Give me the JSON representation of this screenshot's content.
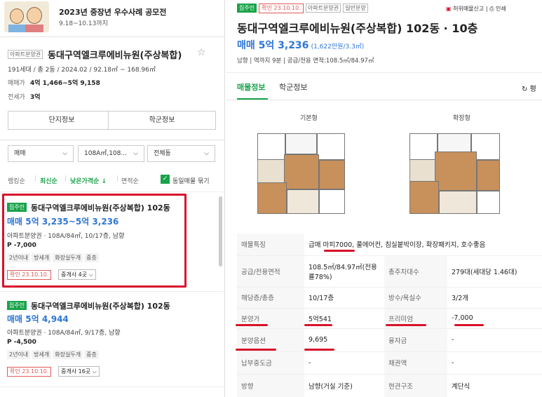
{
  "banner": {
    "title": "2023년 중장년 우수사례 공모전",
    "dates": "9.18~10.13까지"
  },
  "complex": {
    "badge": "아파트분양권",
    "name": "동대구역엘크루에비뉴원(주상복합)",
    "summary": "191세대 / 총 2동 / 2024.02 / 92.18㎡ ~ 168.96㎡",
    "sale_label": "매매가",
    "sale_value": "4억 1,466~5억 9,158",
    "jeonse_label": "전세가",
    "jeonse_value": "3억"
  },
  "buttons": {
    "complex_info": "단지정보",
    "school_info": "학군정보"
  },
  "filters": {
    "type": "매매",
    "area": "108A㎡,108...",
    "building": "전체동"
  },
  "sort": {
    "ranking": "랭킹순",
    "latest": "최신순",
    "low_price": "낮은가격순 ↓",
    "area": "면적순",
    "same_listing": "동일매물 묶기"
  },
  "listings": [
    {
      "badge": "집주인",
      "title": "동대구역엘크루에비뉴원(주상복합) 102동",
      "price": "매매 5억 3,235~5억 3,236",
      "detail": "아파트분양권 · 108A/84㎡, 10/17층, 남향",
      "premium": "P -7,000",
      "features": [
        "2년이내",
        "방세개",
        "화장실두개",
        "중층"
      ],
      "confirmed": "확인 23.10.10.",
      "agents": "중개사 4곳"
    },
    {
      "badge": "집주인",
      "title": "동대구역엘크루에비뉴원(주상복합) 102동",
      "price": "매매 5억 4,944",
      "detail": "아파트분양권 · 108A/84㎡, 9/17층, 남향",
      "premium": "P -4,500",
      "features": [
        "2년이내",
        "방세개",
        "화장실두개",
        "중층"
      ],
      "confirmed": "확인 23.10.10.",
      "agents": "중개사 16곳"
    }
  ],
  "detail": {
    "tags": [
      "집주인",
      "확인 23.10.10.",
      "아파트분양권",
      "일반분양"
    ],
    "report_link": "허위매물신고",
    "print_link": "인쇄",
    "title": "동대구역엘크루에비뉴원(주상복합) 102동 · 10층",
    "price_main": "매매 5억 3,236",
    "price_sub": "(1,622만원/3.3㎡)",
    "meta": "남향 | 역까지 9분 | 공급/전용 면적:108.5㎡/84.97㎡",
    "tabs": [
      "매물정보",
      "학군정보"
    ],
    "refresh": "평",
    "plan_basic": "기본형",
    "plan_extended": "확장형",
    "rows": [
      {
        "k1": "매물특징",
        "v1": "급매 마피7000, 풀에어컨, 침실붙박이장, 확장패키지, 호수좋음",
        "k2": "",
        "v2": ""
      },
      {
        "k1": "공급/전용면적",
        "v1": "108.5㎡/84.97㎡(전용률78%)",
        "k2": "총주차대수",
        "v2": "279대(세대당 1.46대)"
      },
      {
        "k1": "해당층/총층",
        "v1": "10/17층",
        "k2": "방수/욕실수",
        "v2": "3/2개"
      },
      {
        "k1": "분양가",
        "v1": "5억541",
        "k2": "프리미엄",
        "v2": "-7,000"
      },
      {
        "k1": "분양옵션",
        "v1": "9,695",
        "k2": "융자금",
        "v2": "-"
      },
      {
        "k1": "납부중도금",
        "v1": "-",
        "k2": "채권액",
        "v2": "-"
      },
      {
        "k1": "방향",
        "v1": "남향(거실 기준)",
        "k2": "현관구조",
        "v2": "계단식"
      }
    ]
  },
  "colors": {
    "accent_green": "#1aa34a",
    "price_blue": "#2e75d6",
    "highlight_red": "#d8122a"
  }
}
